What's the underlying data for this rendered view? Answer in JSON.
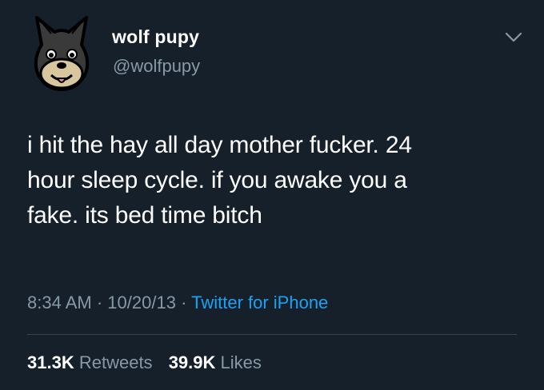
{
  "author": {
    "display_name": "wolf pupy",
    "handle": "@wolfpupy",
    "avatar_icon": "wolf-avatar-icon"
  },
  "tweet": {
    "text_lines": [
      "i hit the hay all day mother fucker. 24",
      "hour sleep cycle. if you awake you a",
      "fake. its bed time bitch"
    ],
    "time": "8:34 AM",
    "separator": "·",
    "date": "10/20/13",
    "source": "Twitter for iPhone"
  },
  "stats": {
    "retweets_count": "31.3K",
    "retweets_label": "Retweets",
    "likes_count": "39.9K",
    "likes_label": "Likes"
  },
  "colors": {
    "background": "#15202b",
    "text": "#ffffff",
    "muted": "#8899a6",
    "link": "#1da1f2",
    "divider": "#38444d"
  },
  "icons": {
    "menu": "chevron-down-icon"
  }
}
